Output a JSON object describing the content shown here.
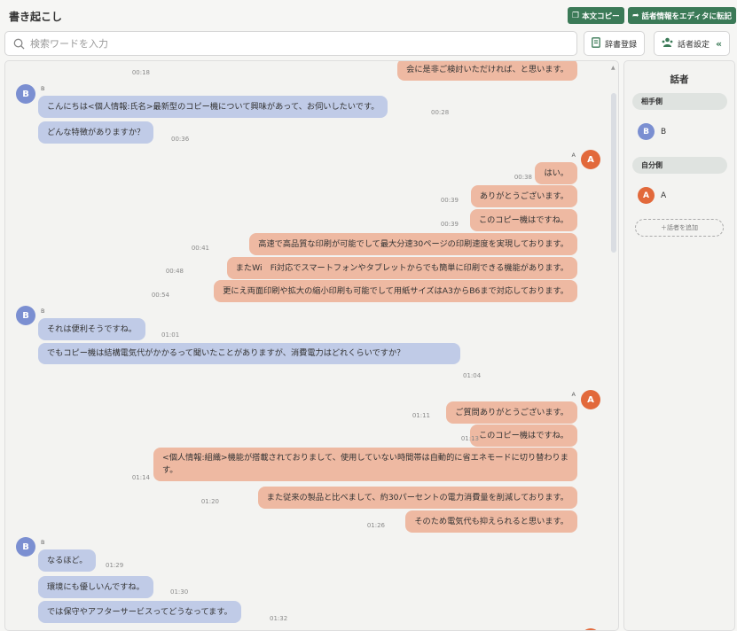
{
  "header": {
    "title": "書き起こし",
    "copy_text_label": "本文コピー",
    "transfer_label": "話者情報をエディタに転記"
  },
  "search": {
    "placeholder": "検索ワードを入力",
    "value": ""
  },
  "toolbar": {
    "dictionary_label": "辞書登録",
    "speaker_settings_label": "話者設定"
  },
  "icons": [
    "copy-icon",
    "share-arrow-icon",
    "search-icon",
    "dictionary-icon",
    "speaker-settings-icon",
    "collapse-icon",
    "scroll-up-icon"
  ],
  "colors": {
    "brand": "#3b7a57",
    "speaker_b_bubble": "#c0cbe7",
    "speaker_a_bubble": "#eeb9a2",
    "speaker_b_avatar": "#7b8fd1",
    "speaker_a_avatar": "#e2693b"
  },
  "messages": [
    {
      "speaker": "A",
      "time": "00:18",
      "text": "会に是非ご検討いただければ、と思います。"
    },
    {
      "speaker": "B",
      "time": "00:28",
      "text": "こんにちは<個人情報:氏名>最新型のコピー機について興味があって、お伺いしたいです。"
    },
    {
      "speaker": "B",
      "time": "00:36",
      "text": "どんな特徴がありますか？"
    },
    {
      "speaker": "A",
      "time": "00:38",
      "text": "はい。"
    },
    {
      "speaker": "A",
      "time": "00:39",
      "text": "ありがとうございます。"
    },
    {
      "speaker": "A",
      "time": "00:39",
      "text": "このコピー機はですね。"
    },
    {
      "speaker": "A",
      "time": "00:41",
      "text": "高速で高品質な印刷が可能でして最大分速30ページの印刷速度を実現しております。"
    },
    {
      "speaker": "A",
      "time": "00:48",
      "text": "またWi　Fi対応でスマートフォンやタブレットからでも簡単に印刷できる機能があります。"
    },
    {
      "speaker": "A",
      "time": "00:54",
      "text": "更にえ両面印刷や拡大の縮小印刷も可能でして用紙サイズはA3からB6まで対応しております。"
    },
    {
      "speaker": "B",
      "time": "01:01",
      "text": "それは便利そうですね。"
    },
    {
      "speaker": "B",
      "time": "01:04",
      "text": "でもコピー機は結構電気代がかかるって聞いたことがありますが、消費電力はどれくらいですか？"
    },
    {
      "speaker": "A",
      "time": "01:11",
      "text": "ご質問ありがとうございます。"
    },
    {
      "speaker": "A",
      "time": "01:13",
      "text": "このコピー機はですね。"
    },
    {
      "speaker": "A",
      "time": "01:14",
      "text": "<個人情報:組織>機能が搭載されておりまして、使用していない時間帯は自動的に省エネモードに切り替わります。"
    },
    {
      "speaker": "A",
      "time": "01:20",
      "text": "また従来の製品と比べまして、約30パーセントの電力消費量を削減しております。"
    },
    {
      "speaker": "A",
      "time": "01:26",
      "text": "そのため電気代も抑えられると思います。"
    },
    {
      "speaker": "B",
      "time": "01:29",
      "text": "なるほど。"
    },
    {
      "speaker": "B",
      "time": "01:30",
      "text": "環境にも優しいんですね。"
    },
    {
      "speaker": "B",
      "time": "01:32",
      "text": "では保守やアフターサービスってどうなってます。"
    }
  ],
  "speaker_labels": {
    "a": "A",
    "b": "B"
  },
  "sidebar": {
    "title": "話者",
    "groups": [
      {
        "label": "相手側",
        "speakers": [
          {
            "initial": "B",
            "name": "B"
          }
        ]
      },
      {
        "label": "自分側",
        "speakers": [
          {
            "initial": "A",
            "name": "A"
          }
        ]
      }
    ],
    "add_label": "＋話者を追加"
  }
}
